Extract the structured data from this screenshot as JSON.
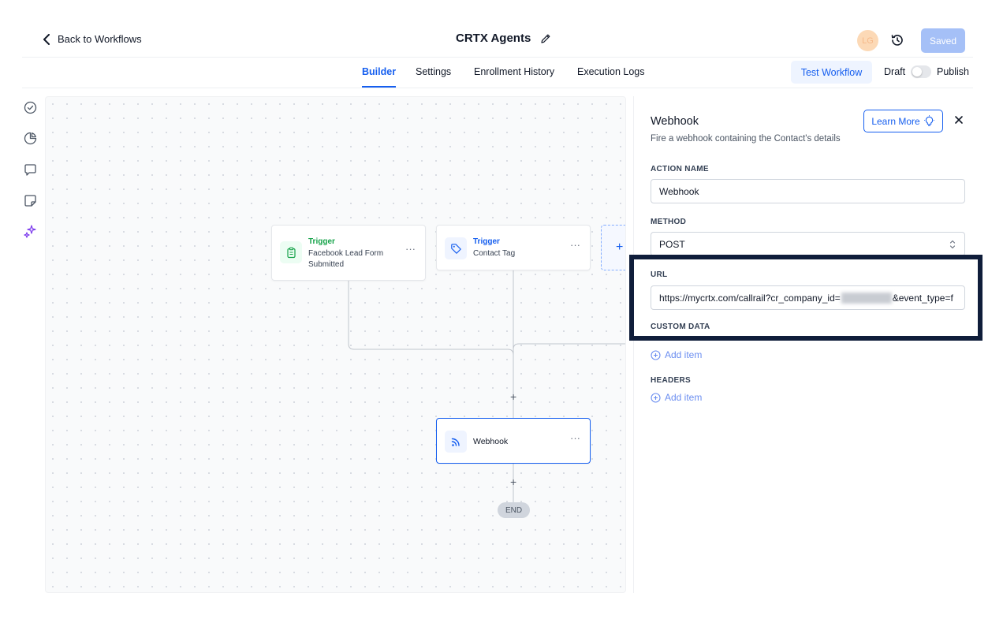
{
  "header": {
    "back_label": "Back to Workflows",
    "title": "CRTX Agents",
    "avatar_initials": "LG",
    "saved_label": "Saved"
  },
  "tabs": [
    {
      "label": "Builder",
      "active": true
    },
    {
      "label": "Settings",
      "active": false
    },
    {
      "label": "Enrollment History",
      "active": false
    },
    {
      "label": "Execution Logs",
      "active": false
    }
  ],
  "actions": {
    "test_workflow_label": "Test Workflow",
    "draft_label": "Draft",
    "publish_label": "Publish",
    "publish_enabled": false
  },
  "rail_icons": [
    "check-circle-icon",
    "pie-chart-icon",
    "message-icon",
    "sticky-note-icon",
    "sparkles-icon"
  ],
  "canvas": {
    "trigger1": {
      "kind": "Trigger",
      "desc": "Facebook Lead Form Submitted",
      "more": "···"
    },
    "trigger2": {
      "kind": "Trigger",
      "desc": "Contact Tag",
      "more": "···"
    },
    "add_trigger": "+",
    "plus1": "+",
    "action": {
      "label": "Webhook",
      "more": "···"
    },
    "plus2": "+",
    "end_label": "END"
  },
  "panel": {
    "title": "Webhook",
    "subtitle": "Fire a webhook containing the Contact's details",
    "learn_more_label": "Learn More",
    "action_name_label": "ACTION NAME",
    "action_name_value": "Webhook",
    "method_label": "METHOD",
    "method_value": "POST",
    "url_label": "URL",
    "url_prefix": "https://mycrtx.com/callrail?cr_company_id=",
    "url_suffix": "&event_type=f",
    "custom_data_label": "CUSTOM DATA",
    "custom_data_add": "Add item",
    "headers_label": "HEADERS",
    "headers_add": "Add item"
  },
  "colors": {
    "accent": "#155eef",
    "highlight_border": "#0f1d3a",
    "trigger_green": "#16a34a",
    "trigger_blue": "#155eef"
  }
}
